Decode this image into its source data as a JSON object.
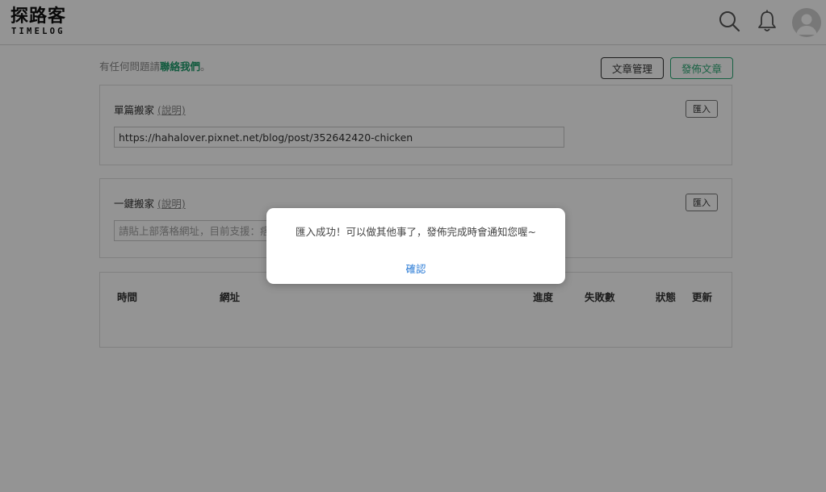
{
  "brand": {
    "name_zh": "探路客",
    "name_en": "TIMELOG"
  },
  "header": {
    "icons": [
      "search-icon",
      "bell-icon",
      "avatar"
    ]
  },
  "help": {
    "prefix": "有任何問題請",
    "contact_link": "聯絡我們",
    "suffix": "。"
  },
  "toolbar": {
    "manage_label": "文章管理",
    "publish_label": "發佈文章"
  },
  "single_move": {
    "title": "單篇搬家",
    "explain": "(說明)",
    "import_label": "匯入",
    "url_value": "https://hahalover.pixnet.net/blog/post/352642420-chicken"
  },
  "onekey_move": {
    "title": "一鍵搬家",
    "explain": "(說明)",
    "import_label": "匯入",
    "placeholder": "請貼上部落格網址，目前支援：痞客邦"
  },
  "table": {
    "columns": [
      "時間",
      "網址",
      "進度",
      "失敗數",
      "狀態",
      "更新"
    ]
  },
  "modal": {
    "message": "匯入成功！可以做其他事了，發佈完成時會通知您喔~",
    "confirm_label": "確認"
  },
  "colors": {
    "accent_green": "#2aa874",
    "link_green": "#1e9c6c",
    "confirm_blue": "#2a7bd6",
    "overlay": "rgba(0,0,0,0.42)"
  }
}
